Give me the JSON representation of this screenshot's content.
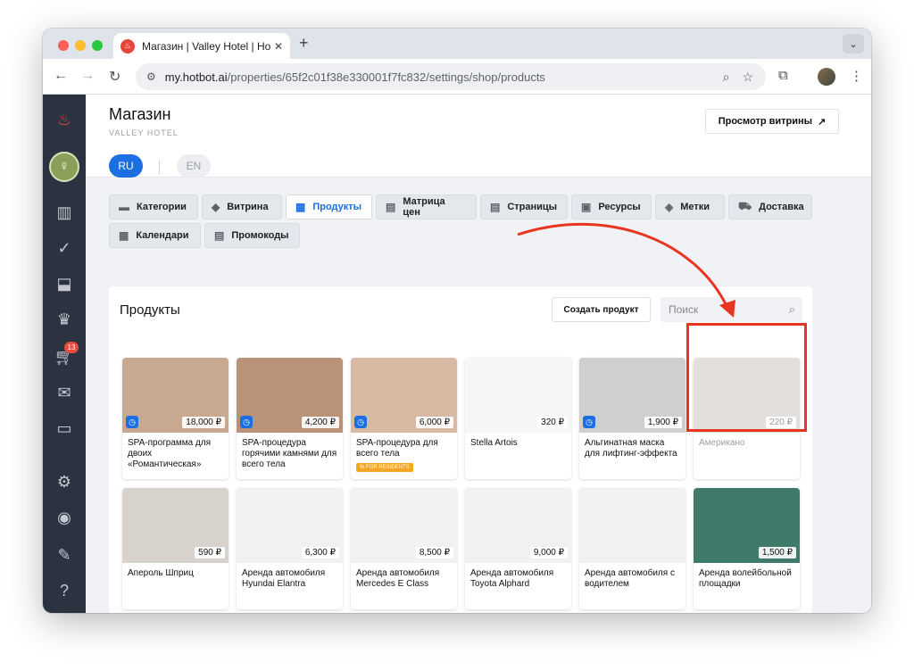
{
  "browser": {
    "tab_title": "Магазин | Valley Hotel | Hotb",
    "new_tab": "+",
    "tab_menu": "⌄",
    "url_host": "my.hotbot.ai",
    "url_path": "/properties/65f2c01f38e330001f7fc832/settings/shop/products"
  },
  "sidebar": {
    "cart_badge": "13",
    "icons": [
      "fire-icon",
      "logo",
      "chart-icon",
      "check-circle-icon",
      "inbox-icon",
      "crown-icon",
      "cart-icon",
      "mail-icon",
      "chat-icon",
      "gear-icon",
      "user-icon",
      "pencil-icon",
      "help-icon"
    ]
  },
  "header": {
    "title": "Магазин",
    "subtitle": "VALLEY HOTEL",
    "storefront_button": "Просмотр витрины",
    "storefront_arrow": "↗",
    "lang_ru": "RU",
    "lang_en": "EN"
  },
  "tabs": [
    {
      "label": "Категории",
      "icon": "▬",
      "active": false
    },
    {
      "label": "Витрина",
      "icon": "◆",
      "active": false
    },
    {
      "label": "Продукты",
      "icon": "▦",
      "active": true
    },
    {
      "label": "Матрица цен",
      "icon": "▤",
      "active": false
    },
    {
      "label": "Страницы",
      "icon": "▤",
      "active": false
    },
    {
      "label": "Ресурсы",
      "icon": "▣",
      "active": false
    },
    {
      "label": "Метки",
      "icon": "◈",
      "active": false
    },
    {
      "label": "Доставка",
      "icon": "⛟",
      "active": false
    },
    {
      "label": "Календари",
      "icon": "▦",
      "active": false
    },
    {
      "label": "Промокоды",
      "icon": "▤",
      "active": false
    }
  ],
  "panel": {
    "title": "Продукты",
    "create_button": "Создать продукт",
    "search_placeholder": "Поиск"
  },
  "products": [
    {
      "name": "SPA-программа для двоих «Романтическая»",
      "price": "18,000 ₽",
      "clock": true,
      "img": "#c9a890"
    },
    {
      "name": "SPA-процедура горячими камнями для всего тела",
      "price": "4,200 ₽",
      "clock": true,
      "img": "#b99277"
    },
    {
      "name": "SPA-процедура для всего тела",
      "price": "6,000 ₽",
      "clock": true,
      "img": "#d8b9a3",
      "tag": "% FOR RESIDENTS"
    },
    {
      "name": "Stella Artois",
      "price": "320 ₽",
      "clock": false,
      "img": "#f6f6f6"
    },
    {
      "name": "Альгинатная маска для лифтинг-эффекта",
      "price": "1,900 ₽",
      "clock": true,
      "img": "#cfcfcf"
    },
    {
      "name": "Американо",
      "price": "220 ₽",
      "clock": false,
      "img": "#ded9d6",
      "faded": true
    },
    {
      "name": "Апероль Шприц",
      "price": "590 ₽",
      "clock": false,
      "img": "#d8d2cc"
    },
    {
      "name": "Аренда автомобиля Hyundai Elantra",
      "price": "6,300 ₽",
      "clock": false,
      "img": "#f1f1f1"
    },
    {
      "name": "Аренда автомобиля Mercedes E Class",
      "price": "8,500 ₽",
      "clock": false,
      "img": "#f1f1f1"
    },
    {
      "name": "Аренда автомобиля Toyota Alphard",
      "price": "9,000 ₽",
      "clock": false,
      "img": "#f1f1f1"
    },
    {
      "name": "Аренда автомобиля с водителем",
      "price": "",
      "clock": false,
      "img": "#f1f1f1"
    },
    {
      "name": "Аренда волейбольной площадки",
      "price": "1,500 ₽",
      "clock": false,
      "img": "#3f7a6a"
    }
  ],
  "partial_row_images": [
    "#4d6a4a",
    "#4f6f54",
    "#5a7050",
    "#c89a6a",
    "#d6b48c",
    "#c79966",
    "#c9b5a5"
  ],
  "colors": {
    "accent": "#1b6fe0",
    "annotation": "#e8351f",
    "sidebar": "#2b3240"
  }
}
